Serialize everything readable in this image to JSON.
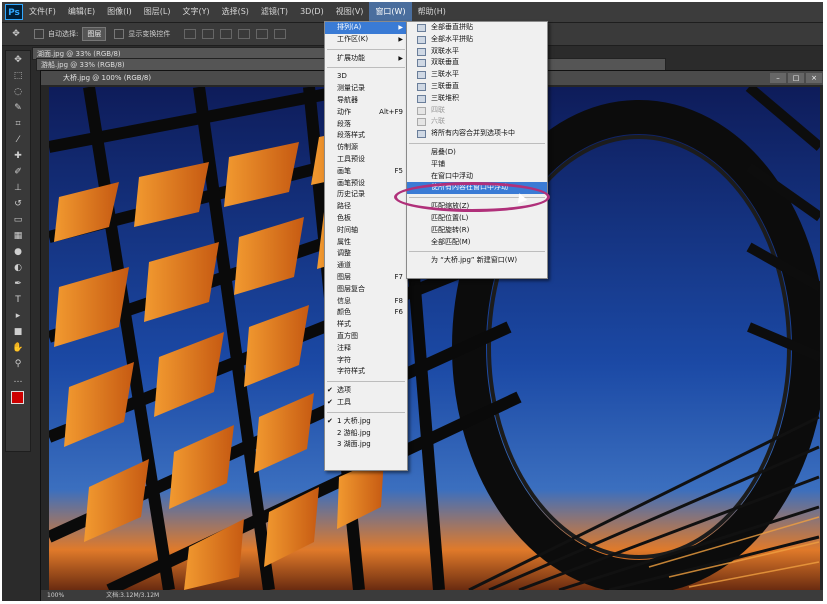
{
  "menubar": {
    "logo": "Ps",
    "items": [
      "文件(F)",
      "编辑(E)",
      "图像(I)",
      "图层(L)",
      "文字(Y)",
      "选择(S)",
      "滤镜(T)",
      "3D(D)",
      "视图(V)",
      "窗口(W)",
      "帮助(H)"
    ],
    "active_index": 9
  },
  "options_bar": {
    "auto_select": "自动选择:",
    "layer_value": "图层",
    "show_transform": "显示变换控件"
  },
  "background_tabs": {
    "tab1": "湖面.jpg @ 33% (RGB/8)",
    "tab2": "游船.jpg @ 33% (RGB/8)"
  },
  "document": {
    "title": "大桥.jpg @ 100% (RGB/8)",
    "status_zoom": "100%",
    "status_doc": "文档:3.12M/3.12M"
  },
  "window_menu": {
    "items": [
      {
        "label": "排列(A)",
        "submenu": true,
        "highlight": true
      },
      {
        "label": "工作区(K)",
        "submenu": true
      },
      {
        "sep": true
      },
      {
        "label": "扩展功能",
        "submenu": true
      },
      {
        "sep": true
      },
      {
        "label": "3D"
      },
      {
        "label": "测量记录"
      },
      {
        "label": "导航器"
      },
      {
        "label": "动作",
        "shortcut": "Alt+F9"
      },
      {
        "label": "段落"
      },
      {
        "label": "段落样式"
      },
      {
        "label": "仿制源"
      },
      {
        "label": "工具预设"
      },
      {
        "label": "画笔",
        "shortcut": "F5"
      },
      {
        "label": "画笔预设"
      },
      {
        "label": "历史记录"
      },
      {
        "label": "路径"
      },
      {
        "label": "色板"
      },
      {
        "label": "时间轴"
      },
      {
        "label": "属性"
      },
      {
        "label": "调整"
      },
      {
        "label": "通道"
      },
      {
        "label": "图层",
        "shortcut": "F7"
      },
      {
        "label": "图层复合"
      },
      {
        "label": "信息",
        "shortcut": "F8"
      },
      {
        "label": "颜色",
        "shortcut": "F6"
      },
      {
        "label": "样式"
      },
      {
        "label": "直方图"
      },
      {
        "label": "注释"
      },
      {
        "label": "字符"
      },
      {
        "label": "字符样式"
      },
      {
        "sep": true
      },
      {
        "label": "选项",
        "checked": true
      },
      {
        "label": "工具",
        "checked": true
      },
      {
        "sep": true
      },
      {
        "label": "1 大桥.jpg",
        "checked": true
      },
      {
        "label": "2 游船.jpg"
      },
      {
        "label": "3 湖面.jpg"
      }
    ]
  },
  "arrange_menu": {
    "items": [
      {
        "label": "全部垂直拼贴",
        "icon": true
      },
      {
        "label": "全部水平拼贴",
        "icon": true
      },
      {
        "label": "双联水平",
        "icon": true
      },
      {
        "label": "双联垂直",
        "icon": true
      },
      {
        "label": "三联水平",
        "icon": true
      },
      {
        "label": "三联垂直",
        "icon": true
      },
      {
        "label": "三联堆积",
        "icon": true
      },
      {
        "label": "四联",
        "icon": true,
        "disabled": true
      },
      {
        "label": "六联",
        "icon": true,
        "disabled": true
      },
      {
        "label": "将所有内容合并到选项卡中",
        "icon": true
      },
      {
        "sep": true
      },
      {
        "label": "层叠(D)"
      },
      {
        "label": "平铺"
      },
      {
        "label": "在窗口中浮动"
      },
      {
        "label": "使所有内容在窗口中浮动",
        "highlight": true
      },
      {
        "sep": true
      },
      {
        "label": "匹配缩放(Z)"
      },
      {
        "label": "匹配位置(L)"
      },
      {
        "label": "匹配旋转(R)"
      },
      {
        "label": "全部匹配(M)"
      },
      {
        "sep": true
      },
      {
        "label": "为 “大桥.jpg” 新建窗口(W)"
      }
    ]
  },
  "colors": {
    "menu_highlight": "#3a7bd5",
    "annotation_ellipse": "#b0307a",
    "bridge_orange": "#e8801e",
    "sky_blue": "#1a3f8a"
  }
}
